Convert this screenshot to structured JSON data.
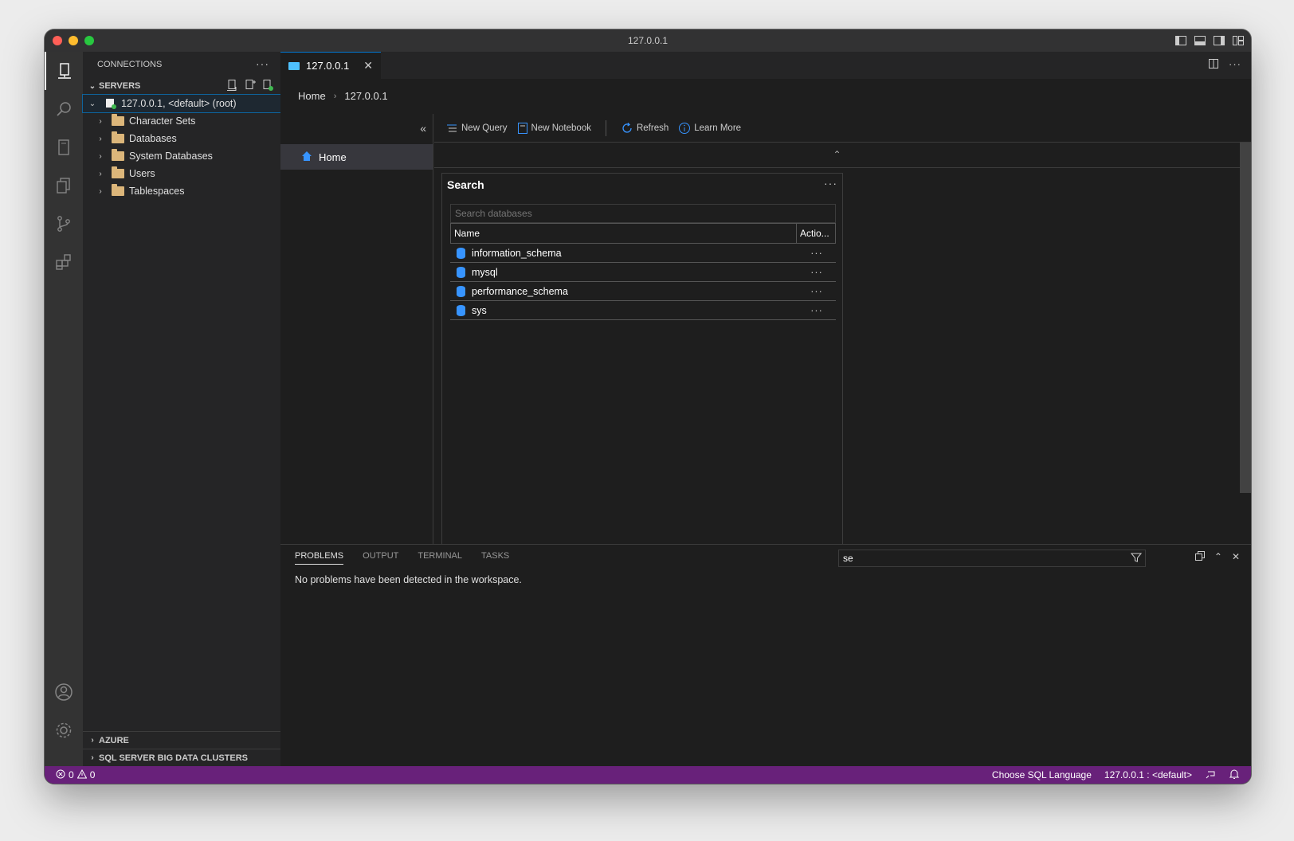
{
  "window": {
    "title": "127.0.0.1"
  },
  "sidebar": {
    "title": "CONNECTIONS",
    "more": "···",
    "servers_section": "SERVERS",
    "server_node": "127.0.0.1, <default> (root)",
    "children": [
      {
        "label": "Character Sets"
      },
      {
        "label": "Databases"
      },
      {
        "label": "System Databases"
      },
      {
        "label": "Users"
      },
      {
        "label": "Tablespaces"
      }
    ],
    "bottom_sections": [
      "AZURE",
      "SQL SERVER BIG DATA CLUSTERS"
    ]
  },
  "editor": {
    "tab_label": "127.0.0.1",
    "breadcrumb": {
      "home": "Home",
      "current": "127.0.0.1"
    },
    "nav_item": "Home",
    "toolbar": {
      "new_query": "New Query",
      "new_notebook": "New Notebook",
      "refresh": "Refresh",
      "learn_more": "Learn More"
    },
    "search_card": {
      "title": "Search",
      "placeholder": "Search databases",
      "columns": [
        "Name",
        "Actio..."
      ],
      "rows": [
        {
          "name": "information_schema",
          "actions": "···"
        },
        {
          "name": "mysql",
          "actions": "···"
        },
        {
          "name": "performance_schema",
          "actions": "···"
        },
        {
          "name": "sys",
          "actions": "···"
        }
      ]
    }
  },
  "panel": {
    "tabs": [
      "PROBLEMS",
      "OUTPUT",
      "TERMINAL",
      "TASKS"
    ],
    "active_tab": "PROBLEMS",
    "filter_value": "se",
    "message": "No problems have been detected in the workspace."
  },
  "statusbar": {
    "errors": "0",
    "warnings": "0",
    "language": "Choose SQL Language",
    "connection": "127.0.0.1 : <default>"
  },
  "colors": {
    "status_bg": "#68217a",
    "accent": "#0078d4",
    "db_icon": "#3794ff",
    "folder": "#dcb67a"
  }
}
